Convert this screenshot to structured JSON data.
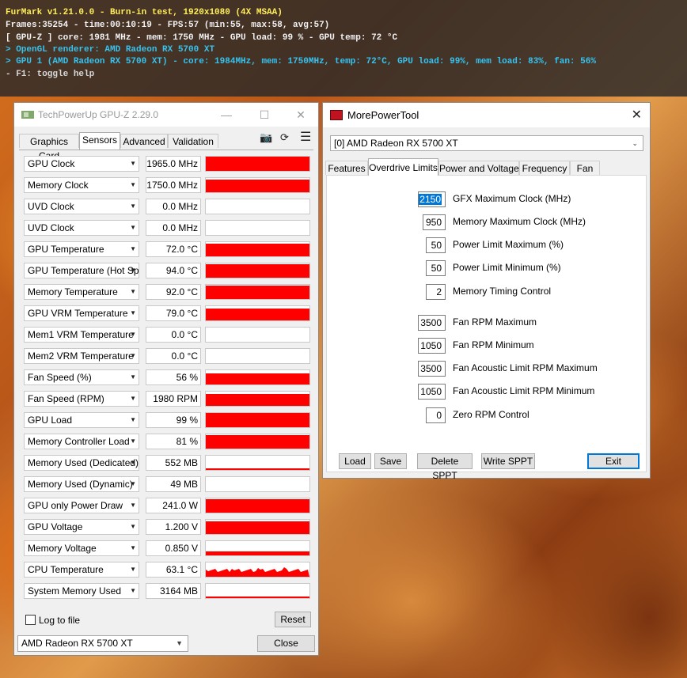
{
  "hud": {
    "line1": "FurMark v1.21.0.0 - Burn-in test, 1920x1080 (4X MSAA)",
    "line2": "Frames:35254 - time:00:10:19 - FPS:57 (min:55, max:58, avg:57)",
    "line3": "[ GPU-Z ] core: 1981 MHz - mem: 1750 MHz - GPU load: 99 % - GPU temp: 72 °C",
    "line4": "> OpenGL renderer: AMD Radeon RX 5700 XT",
    "line5": "> GPU 1 (AMD Radeon RX 5700 XT) - core: 1984MHz, mem: 1750MHz, temp: 72°C, GPU load: 99%, mem load: 83%, fan: 56%",
    "line6": "- F1: toggle help"
  },
  "gpuz": {
    "title": "TechPowerUp GPU-Z 2.29.0",
    "tabs": [
      "Graphics Card",
      "Sensors",
      "Advanced",
      "Validation"
    ],
    "active_tab": "Sensors",
    "sensors": [
      {
        "name": "GPU Clock",
        "value": "1965.0 MHz",
        "level": 1.0,
        "kind": "full"
      },
      {
        "name": "Memory Clock",
        "value": "1750.0 MHz",
        "level": 0.7,
        "kind": "full"
      },
      {
        "name": "UVD Clock",
        "value": "0.0 MHz",
        "level": 0,
        "kind": "empty"
      },
      {
        "name": "UVD Clock",
        "value": "0.0 MHz",
        "level": 0,
        "kind": "empty"
      },
      {
        "name": "GPU Temperature",
        "value": "72.0 °C",
        "level": 0.75,
        "kind": "full"
      },
      {
        "name": "GPU Temperature (Hot Spot)",
        "value": "94.0 °C",
        "level": 0.85,
        "kind": "full"
      },
      {
        "name": "Memory Temperature",
        "value": "92.0 °C",
        "level": 0.8,
        "kind": "full"
      },
      {
        "name": "GPU VRM Temperature",
        "value": "79.0 °C",
        "level": 0.65,
        "kind": "full"
      },
      {
        "name": "Mem1 VRM Temperature",
        "value": "0.0 °C",
        "level": 0,
        "kind": "empty"
      },
      {
        "name": "Mem2 VRM Temperature",
        "value": "0.0 °C",
        "level": 0,
        "kind": "empty"
      },
      {
        "name": "Fan Speed (%)",
        "value": "56 %",
        "level": 0.5,
        "kind": "full"
      },
      {
        "name": "Fan Speed (RPM)",
        "value": "1980 RPM",
        "level": 0.55,
        "kind": "full"
      },
      {
        "name": "GPU Load",
        "value": "99 %",
        "level": 0.99,
        "kind": "full"
      },
      {
        "name": "Memory Controller Load",
        "value": "81 %",
        "level": 0.81,
        "kind": "full"
      },
      {
        "name": "Memory Used (Dedicated)",
        "value": "552 MB",
        "level": 0.1,
        "kind": "line"
      },
      {
        "name": "Memory Used (Dynamic)",
        "value": "49 MB",
        "level": 0.03,
        "kind": "empty"
      },
      {
        "name": "GPU only Power Draw",
        "value": "241.0 W",
        "level": 0.9,
        "kind": "full"
      },
      {
        "name": "GPU Voltage",
        "value": "1.200 V",
        "level": 0.7,
        "kind": "full"
      },
      {
        "name": "Memory Voltage",
        "value": "0.850 V",
        "level": 0.3,
        "kind": "half"
      },
      {
        "name": "CPU Temperature",
        "value": "63.1 °C",
        "level": 0.45,
        "kind": "noisy"
      },
      {
        "name": "System Memory Used",
        "value": "3164 MB",
        "level": 0.15,
        "kind": "line"
      }
    ],
    "log_label": "Log to file",
    "reset_label": "Reset",
    "device_select": "AMD Radeon RX 5700 XT",
    "close_label": "Close",
    "accent": "#ff0000"
  },
  "mpt": {
    "title": "MorePowerTool",
    "device_select": "[0] AMD Radeon RX 5700 XT",
    "tabs": [
      "Features",
      "Overdrive Limits",
      "Power and Voltage",
      "Frequency",
      "Fan"
    ],
    "active_tab": "Overdrive Limits",
    "params": [
      {
        "value": "2150",
        "label": "GFX Maximum Clock (MHz)"
      },
      {
        "value": "950",
        "label": "Memory Maximum Clock (MHz)"
      },
      {
        "value": "50",
        "label": "Power Limit Maximum (%)"
      },
      {
        "value": "50",
        "label": "Power Limit Minimum (%)"
      },
      {
        "value": "2",
        "label": "Memory Timing Control"
      },
      {
        "value": "3500",
        "label": "Fan RPM Maximum"
      },
      {
        "value": "1050",
        "label": "Fan RPM Minimum"
      },
      {
        "value": "3500",
        "label": "Fan Acoustic Limit RPM Maximum"
      },
      {
        "value": "1050",
        "label": "Fan Acoustic Limit RPM Minimum"
      },
      {
        "value": "0",
        "label": "Zero RPM Control"
      }
    ],
    "buttons": {
      "load": "Load",
      "save": "Save",
      "delete": "Delete SPPT",
      "write": "Write SPPT",
      "exit": "Exit"
    }
  }
}
